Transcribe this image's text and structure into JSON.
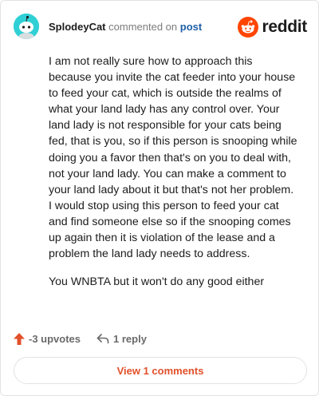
{
  "comment": {
    "username": "SplodeyCat",
    "action_text": "commented on",
    "target_link": "post",
    "paragraphs": [
      "I am not really sure how to approach this because you invite the cat feeder into your house to feed your cat, which is outside the realms of what your land lady has any control over. Your land lady is not responsible for your cats being fed, that is you, so if this person is snooping while doing you a favor then that's on you to deal with, not your land lady. You can make a comment to your land lady about it but that's not her problem. I would stop using this person to feed your cat and find someone else so if the snooping comes up again then it is violation of the lease and a problem the land lady needs to address.",
      "You WNBTA but it won't do any good either"
    ]
  },
  "brand": {
    "wordmark": "reddit",
    "icon": "reddit-snoo-icon",
    "color": "#ff4500"
  },
  "actions": {
    "upvotes": "-3 upvotes",
    "upvote_icon": "upvote-arrow-icon",
    "upvote_color": "#e2502b",
    "replies": "1 reply",
    "reply_icon": "reply-arrow-icon"
  },
  "view_comments_label": "View 1 comments",
  "colors": {
    "accent": "#e2502b",
    "avatar_bg": "#2fd0d5",
    "link": "#1f5fa8"
  }
}
